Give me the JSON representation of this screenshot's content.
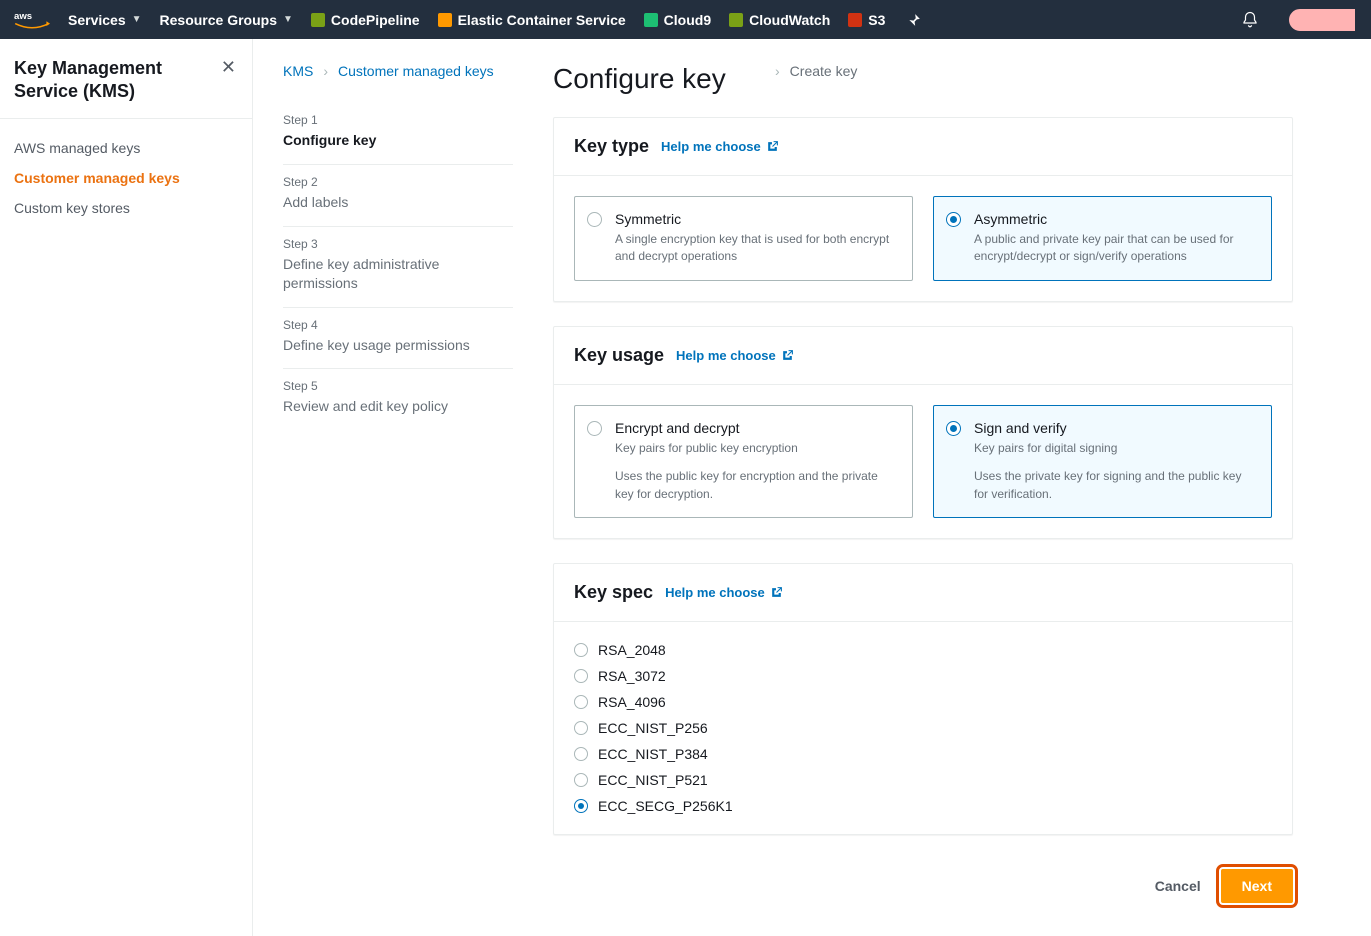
{
  "topnav": {
    "services": "Services",
    "resource_groups": "Resource Groups",
    "pins": [
      {
        "label": "CodePipeline",
        "color": "#7aa116"
      },
      {
        "label": "Elastic Container Service",
        "color": "#ff9900"
      },
      {
        "label": "Cloud9",
        "color": "#1dbf73"
      },
      {
        "label": "CloudWatch",
        "color": "#7aa116"
      },
      {
        "label": "S3",
        "color": "#d13212"
      }
    ]
  },
  "sidebar": {
    "title": "Key Management Service (KMS)",
    "items": [
      {
        "label": "AWS managed keys",
        "active": false
      },
      {
        "label": "Customer managed keys",
        "active": true
      },
      {
        "label": "Custom key stores",
        "active": false
      }
    ]
  },
  "breadcrumb": {
    "root": "KMS",
    "mid": "Customer managed keys",
    "current": "Create key"
  },
  "wizard": {
    "steps": [
      {
        "num": "Step 1",
        "title": "Configure key",
        "current": true
      },
      {
        "num": "Step 2",
        "title": "Add labels",
        "current": false
      },
      {
        "num": "Step 3",
        "title": "Define key administrative permissions",
        "current": false
      },
      {
        "num": "Step 4",
        "title": "Define key usage permissions",
        "current": false
      },
      {
        "num": "Step 5",
        "title": "Review and edit key policy",
        "current": false
      }
    ]
  },
  "page": {
    "title": "Configure key",
    "help": "Help me choose"
  },
  "keytype": {
    "heading": "Key type",
    "opts": [
      {
        "title": "Symmetric",
        "desc": "A single encryption key that is used for both encrypt and decrypt operations",
        "selected": false
      },
      {
        "title": "Asymmetric",
        "desc": "A public and private key pair that can be used for encrypt/decrypt or sign/verify operations",
        "selected": true
      }
    ]
  },
  "keyusage": {
    "heading": "Key usage",
    "opts": [
      {
        "title": "Encrypt and decrypt",
        "sub": "Key pairs for public key encryption",
        "desc": "Uses the public key for encryption and the private key for decryption.",
        "selected": false
      },
      {
        "title": "Sign and verify",
        "sub": "Key pairs for digital signing",
        "desc": "Uses the private key for signing and the public key for verification.",
        "selected": true
      }
    ]
  },
  "keyspec": {
    "heading": "Key spec",
    "opts": [
      {
        "label": "RSA_2048",
        "selected": false
      },
      {
        "label": "RSA_3072",
        "selected": false
      },
      {
        "label": "RSA_4096",
        "selected": false
      },
      {
        "label": "ECC_NIST_P256",
        "selected": false
      },
      {
        "label": "ECC_NIST_P384",
        "selected": false
      },
      {
        "label": "ECC_NIST_P521",
        "selected": false
      },
      {
        "label": "ECC_SECG_P256K1",
        "selected": true
      }
    ]
  },
  "actions": {
    "cancel": "Cancel",
    "next": "Next"
  }
}
